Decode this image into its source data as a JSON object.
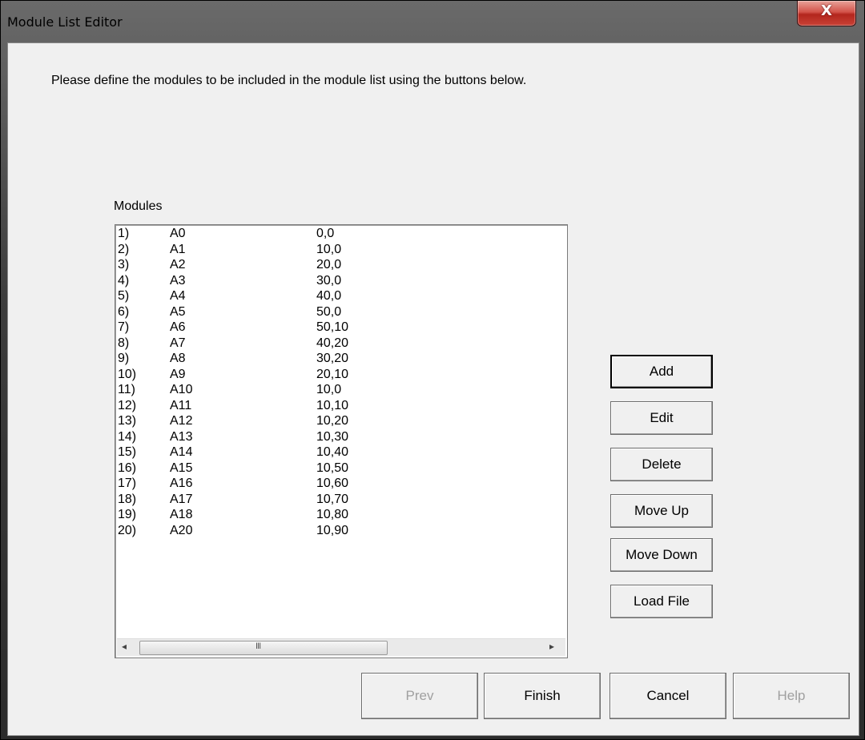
{
  "window": {
    "title": "Module List Editor",
    "close_glyph": "X",
    "close_icon": "close-icon"
  },
  "intro_text": "Please define the modules to be included in the module list using the buttons below.",
  "modules_label": "Modules",
  "modules": [
    {
      "idx": "1)",
      "name": "A0",
      "pos": "0,0"
    },
    {
      "idx": "2)",
      "name": "A1",
      "pos": "10,0"
    },
    {
      "idx": "3)",
      "name": "A2",
      "pos": "20,0"
    },
    {
      "idx": "4)",
      "name": "A3",
      "pos": "30,0"
    },
    {
      "idx": "5)",
      "name": "A4",
      "pos": "40,0"
    },
    {
      "idx": "6)",
      "name": "A5",
      "pos": "50,0"
    },
    {
      "idx": "7)",
      "name": "A6",
      "pos": "50,10"
    },
    {
      "idx": "8)",
      "name": "A7",
      "pos": "40,20"
    },
    {
      "idx": "9)",
      "name": "A8",
      "pos": "30,20"
    },
    {
      "idx": "10)",
      "name": "A9",
      "pos": "20,10"
    },
    {
      "idx": "11)",
      "name": "A10",
      "pos": "10,0"
    },
    {
      "idx": "12)",
      "name": "A11",
      "pos": "10,10"
    },
    {
      "idx": "13)",
      "name": "A12",
      "pos": "10,20"
    },
    {
      "idx": "14)",
      "name": "A13",
      "pos": "10,30"
    },
    {
      "idx": "15)",
      "name": "A14",
      "pos": "10,40"
    },
    {
      "idx": "16)",
      "name": "A15",
      "pos": "10,50"
    },
    {
      "idx": "17)",
      "name": "A16",
      "pos": "10,60"
    },
    {
      "idx": "18)",
      "name": "A17",
      "pos": "10,70"
    },
    {
      "idx": "19)",
      "name": "A18",
      "pos": "10,80"
    },
    {
      "idx": "20)",
      "name": "A20",
      "pos": "10,90"
    }
  ],
  "scrollbar": {
    "left_arrow": "◂",
    "right_arrow": "▸",
    "grip": "III"
  },
  "side_buttons": {
    "add": "Add",
    "edit": "Edit",
    "delete": "Delete",
    "move_up": "Move Up",
    "move_down": "Move Down",
    "load_file": "Load File"
  },
  "bottom_buttons": {
    "prev": "Prev",
    "finish": "Finish",
    "cancel": "Cancel",
    "help": "Help"
  }
}
